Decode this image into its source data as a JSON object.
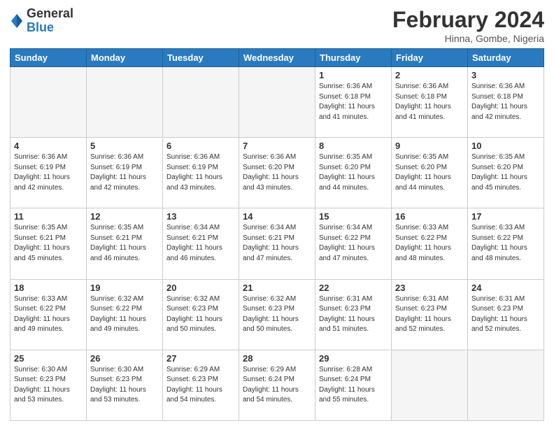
{
  "header": {
    "logo_general": "General",
    "logo_blue": "Blue",
    "month_title": "February 2024",
    "location": "Hinna, Gombe, Nigeria"
  },
  "days_of_week": [
    "Sunday",
    "Monday",
    "Tuesday",
    "Wednesday",
    "Thursday",
    "Friday",
    "Saturday"
  ],
  "weeks": [
    [
      {
        "day": "",
        "info": "",
        "empty": true
      },
      {
        "day": "",
        "info": "",
        "empty": true
      },
      {
        "day": "",
        "info": "",
        "empty": true
      },
      {
        "day": "",
        "info": "",
        "empty": true
      },
      {
        "day": "1",
        "info": "Sunrise: 6:36 AM\nSunset: 6:18 PM\nDaylight: 11 hours\nand 41 minutes.",
        "empty": false
      },
      {
        "day": "2",
        "info": "Sunrise: 6:36 AM\nSunset: 6:18 PM\nDaylight: 11 hours\nand 41 minutes.",
        "empty": false
      },
      {
        "day": "3",
        "info": "Sunrise: 6:36 AM\nSunset: 6:18 PM\nDaylight: 11 hours\nand 42 minutes.",
        "empty": false
      }
    ],
    [
      {
        "day": "4",
        "info": "Sunrise: 6:36 AM\nSunset: 6:19 PM\nDaylight: 11 hours\nand 42 minutes.",
        "empty": false
      },
      {
        "day": "5",
        "info": "Sunrise: 6:36 AM\nSunset: 6:19 PM\nDaylight: 11 hours\nand 42 minutes.",
        "empty": false
      },
      {
        "day": "6",
        "info": "Sunrise: 6:36 AM\nSunset: 6:19 PM\nDaylight: 11 hours\nand 43 minutes.",
        "empty": false
      },
      {
        "day": "7",
        "info": "Sunrise: 6:36 AM\nSunset: 6:20 PM\nDaylight: 11 hours\nand 43 minutes.",
        "empty": false
      },
      {
        "day": "8",
        "info": "Sunrise: 6:35 AM\nSunset: 6:20 PM\nDaylight: 11 hours\nand 44 minutes.",
        "empty": false
      },
      {
        "day": "9",
        "info": "Sunrise: 6:35 AM\nSunset: 6:20 PM\nDaylight: 11 hours\nand 44 minutes.",
        "empty": false
      },
      {
        "day": "10",
        "info": "Sunrise: 6:35 AM\nSunset: 6:20 PM\nDaylight: 11 hours\nand 45 minutes.",
        "empty": false
      }
    ],
    [
      {
        "day": "11",
        "info": "Sunrise: 6:35 AM\nSunset: 6:21 PM\nDaylight: 11 hours\nand 45 minutes.",
        "empty": false
      },
      {
        "day": "12",
        "info": "Sunrise: 6:35 AM\nSunset: 6:21 PM\nDaylight: 11 hours\nand 46 minutes.",
        "empty": false
      },
      {
        "day": "13",
        "info": "Sunrise: 6:34 AM\nSunset: 6:21 PM\nDaylight: 11 hours\nand 46 minutes.",
        "empty": false
      },
      {
        "day": "14",
        "info": "Sunrise: 6:34 AM\nSunset: 6:21 PM\nDaylight: 11 hours\nand 47 minutes.",
        "empty": false
      },
      {
        "day": "15",
        "info": "Sunrise: 6:34 AM\nSunset: 6:22 PM\nDaylight: 11 hours\nand 47 minutes.",
        "empty": false
      },
      {
        "day": "16",
        "info": "Sunrise: 6:33 AM\nSunset: 6:22 PM\nDaylight: 11 hours\nand 48 minutes.",
        "empty": false
      },
      {
        "day": "17",
        "info": "Sunrise: 6:33 AM\nSunset: 6:22 PM\nDaylight: 11 hours\nand 48 minutes.",
        "empty": false
      }
    ],
    [
      {
        "day": "18",
        "info": "Sunrise: 6:33 AM\nSunset: 6:22 PM\nDaylight: 11 hours\nand 49 minutes.",
        "empty": false
      },
      {
        "day": "19",
        "info": "Sunrise: 6:32 AM\nSunset: 6:22 PM\nDaylight: 11 hours\nand 49 minutes.",
        "empty": false
      },
      {
        "day": "20",
        "info": "Sunrise: 6:32 AM\nSunset: 6:23 PM\nDaylight: 11 hours\nand 50 minutes.",
        "empty": false
      },
      {
        "day": "21",
        "info": "Sunrise: 6:32 AM\nSunset: 6:23 PM\nDaylight: 11 hours\nand 50 minutes.",
        "empty": false
      },
      {
        "day": "22",
        "info": "Sunrise: 6:31 AM\nSunset: 6:23 PM\nDaylight: 11 hours\nand 51 minutes.",
        "empty": false
      },
      {
        "day": "23",
        "info": "Sunrise: 6:31 AM\nSunset: 6:23 PM\nDaylight: 11 hours\nand 52 minutes.",
        "empty": false
      },
      {
        "day": "24",
        "info": "Sunrise: 6:31 AM\nSunset: 6:23 PM\nDaylight: 11 hours\nand 52 minutes.",
        "empty": false
      }
    ],
    [
      {
        "day": "25",
        "info": "Sunrise: 6:30 AM\nSunset: 6:23 PM\nDaylight: 11 hours\nand 53 minutes.",
        "empty": false
      },
      {
        "day": "26",
        "info": "Sunrise: 6:30 AM\nSunset: 6:23 PM\nDaylight: 11 hours\nand 53 minutes.",
        "empty": false
      },
      {
        "day": "27",
        "info": "Sunrise: 6:29 AM\nSunset: 6:23 PM\nDaylight: 11 hours\nand 54 minutes.",
        "empty": false
      },
      {
        "day": "28",
        "info": "Sunrise: 6:29 AM\nSunset: 6:24 PM\nDaylight: 11 hours\nand 54 minutes.",
        "empty": false
      },
      {
        "day": "29",
        "info": "Sunrise: 6:28 AM\nSunset: 6:24 PM\nDaylight: 11 hours\nand 55 minutes.",
        "empty": false
      },
      {
        "day": "",
        "info": "",
        "empty": true
      },
      {
        "day": "",
        "info": "",
        "empty": true
      }
    ]
  ]
}
